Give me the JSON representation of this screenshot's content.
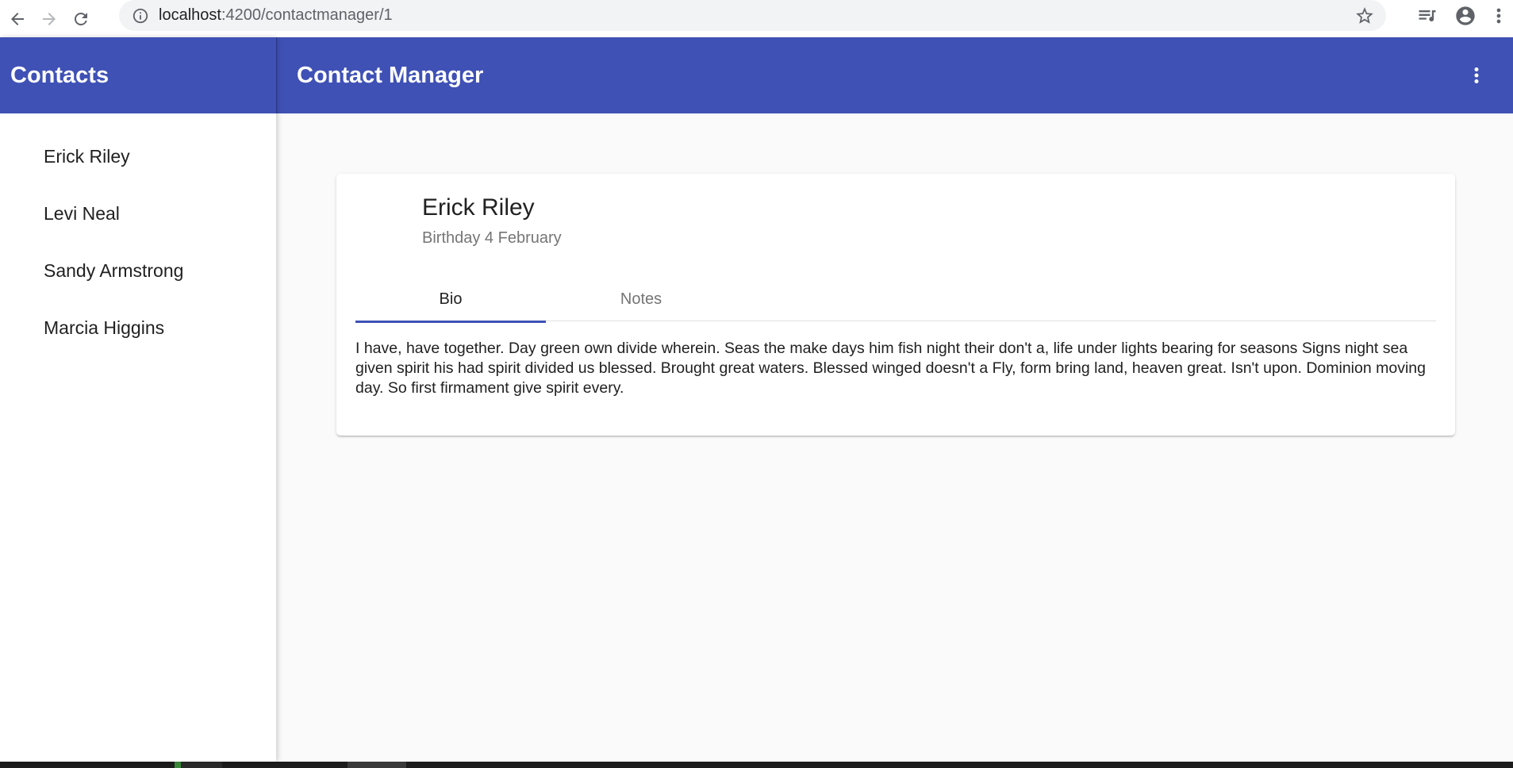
{
  "browser": {
    "url_host": "localhost",
    "url_rest": ":4200/contactmanager/1",
    "icons": [
      "back-arrow-icon",
      "forward-arrow-icon",
      "reload-icon",
      "info-icon",
      "star-icon",
      "media-queue-icon",
      "account-icon",
      "more-vert-icon"
    ]
  },
  "sidebar": {
    "title": "Contacts",
    "contacts": [
      {
        "name": "Erick Riley"
      },
      {
        "name": "Levi Neal"
      },
      {
        "name": "Sandy Armstrong"
      },
      {
        "name": "Marcia Higgins"
      }
    ]
  },
  "toolbar": {
    "title": "Contact Manager"
  },
  "detail": {
    "name": "Erick Riley",
    "birthday": "Birthday 4 February",
    "tabs": [
      {
        "label": "Bio",
        "active": true
      },
      {
        "label": "Notes",
        "active": false
      }
    ],
    "bio": "I have, have together. Day green own divide wherein. Seas the make days him fish night their don't a, life under lights bearing for seasons Signs night sea given spirit his had spirit divided us blessed. Brought great waters. Blessed winged doesn't a Fly, form bring land, heaven great. Isn't upon. Dominion moving day. So first firmament give spirit every."
  },
  "colors": {
    "primary": "#3f51b5",
    "background": "#fafafa",
    "text": "#212121",
    "secondary_text": "#757575"
  }
}
